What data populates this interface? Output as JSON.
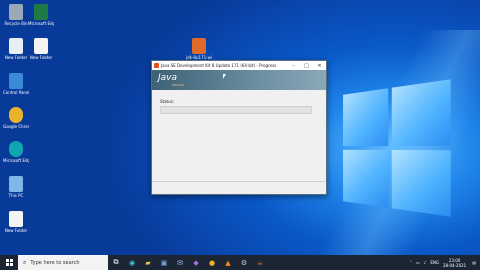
{
  "desktop": {
    "icons": [
      {
        "label": "Recycle Bin",
        "icon": "recycle-bin-icon",
        "color": "#9aa8b8"
      },
      {
        "label": "Microsoft Edge",
        "icon": "excel-file-icon",
        "color": "#1e7b45"
      },
      {
        "label": "Google Chrome",
        "icon": "chrome-icon",
        "color": "#e9b42a"
      },
      {
        "label": "Microsoft Edge",
        "icon": "edge-icon",
        "color": "#0fa6b0"
      },
      {
        "label": "Control Panel",
        "icon": "control-panel-icon",
        "color": "#3a8ad8"
      },
      {
        "label": "This PC",
        "icon": "this-pc-icon",
        "color": "#7fb6e8"
      },
      {
        "label": "New Folder",
        "icon": "file-icon",
        "color": "#f4f4f4"
      },
      {
        "label": "New Folder",
        "icon": "file-icon",
        "color": "#f4f4f4"
      },
      {
        "label": "jdk-8u171-windows-x64",
        "icon": "java-installer-icon",
        "color": "#e06a2a"
      }
    ]
  },
  "installer": {
    "title": "Java SE Development Kit 8 Update 171 (64-bit) - Progress",
    "banner_logo": "Java",
    "banner_sub": "ORACLE",
    "status_label": "Status:",
    "progress": 0,
    "minimize": "–",
    "maximize": "□",
    "close": "✕"
  },
  "taskbar": {
    "search_placeholder": "Type here to search",
    "apps": [
      "task-view-icon",
      "edge-icon",
      "file-explorer-icon",
      "store-icon",
      "mail-icon",
      "visual-studio-icon",
      "chrome-icon",
      "vlc-icon",
      "settings-icon",
      "java-icon"
    ],
    "tray_lang": "ENG",
    "time": "23:00",
    "date": "28-04-2021"
  },
  "colors": {
    "desktop_accent": "#1f86ea",
    "banner": "#3d6276",
    "taskbar": "#1b2533"
  }
}
